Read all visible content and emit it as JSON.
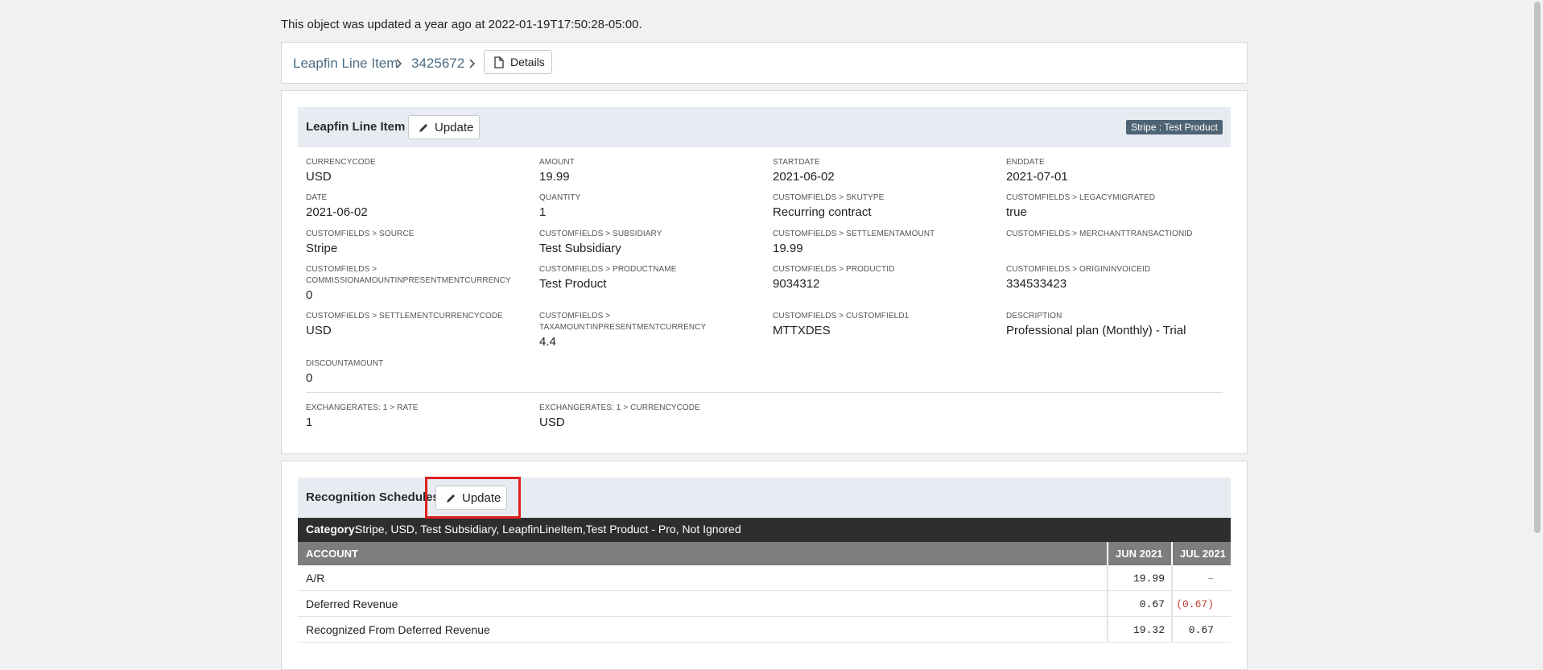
{
  "updated_note": "This object was updated a year ago at 2022-01-19T17:50:28-05:00.",
  "breadcrumb": {
    "items": [
      "Leapfin Line Item",
      "3425672"
    ],
    "details_label": "Details"
  },
  "line_item": {
    "title": "Leapfin Line Item",
    "update_label": "Update",
    "badge": "Stripe : Test Product",
    "fields": [
      {
        "label": "CURRENCYCODE",
        "value": "USD"
      },
      {
        "label": "AMOUNT",
        "value": "19.99"
      },
      {
        "label": "STARTDATE",
        "value": "2021-06-02"
      },
      {
        "label": "ENDDATE",
        "value": "2021-07-01"
      },
      {
        "label": "DATE",
        "value": "2021-06-02"
      },
      {
        "label": "QUANTITY",
        "value": "1"
      },
      {
        "label": "CUSTOMFIELDS > SKUTYPE",
        "value": "Recurring contract"
      },
      {
        "label": "CUSTOMFIELDS > LEGACYMIGRATED",
        "value": "true"
      },
      {
        "label": "CUSTOMFIELDS > SOURCE",
        "value": "Stripe"
      },
      {
        "label": "CUSTOMFIELDS > SUBSIDIARY",
        "value": "Test Subsidiary"
      },
      {
        "label": "CUSTOMFIELDS > SETTLEMENTAMOUNT",
        "value": "19.99"
      },
      {
        "label": "CUSTOMFIELDS > MERCHANTTRANSACTIONID",
        "value": ""
      },
      {
        "label": "CUSTOMFIELDS > COMMISSIONAMOUNTINPRESENTMENTCURRENCY",
        "value": "0"
      },
      {
        "label": "CUSTOMFIELDS > PRODUCTNAME",
        "value": "Test Product"
      },
      {
        "label": "CUSTOMFIELDS > PRODUCTID",
        "value": "9034312"
      },
      {
        "label": "CUSTOMFIELDS > ORIGININVOICEID",
        "value": "334533423"
      },
      {
        "label": "CUSTOMFIELDS > SETTLEMENTCURRENCYCODE",
        "value": "USD"
      },
      {
        "label": "CUSTOMFIELDS > TAXAMOUNTINPRESENTMENTCURRENCY",
        "value": "4.4"
      },
      {
        "label": "CUSTOMFIELDS > CUSTOMFIELD1",
        "value": "MTTXDES"
      },
      {
        "label": "DESCRIPTION",
        "value": "Professional plan (Monthly) - Trial"
      },
      {
        "label": "DISCOUNTAMOUNT",
        "value": "0"
      },
      {
        "label": "EXCHANGERATES: 1 > RATE",
        "value": "1"
      },
      {
        "label": "EXCHANGERATES: 1 > CURRENCYCODE",
        "value": "USD"
      }
    ]
  },
  "recognition": {
    "title": "Recognition Schedules",
    "update_label": "Update",
    "category_key": "Category:",
    "category_value": "Stripe, USD, Test Subsidiary, LeapfinLineItem,Test Product - Pro, Not Ignored",
    "columns": [
      "ACCOUNT",
      "JUN 2021",
      "JUL 2021"
    ],
    "rows": [
      {
        "account": "A/R",
        "jun": "19.99",
        "jul": "–"
      },
      {
        "account": "Deferred Revenue",
        "jun": "0.67",
        "jul": "(0.67)"
      },
      {
        "account": "Recognized From Deferred Revenue",
        "jun": "19.32",
        "jul": "0.67"
      }
    ]
  }
}
